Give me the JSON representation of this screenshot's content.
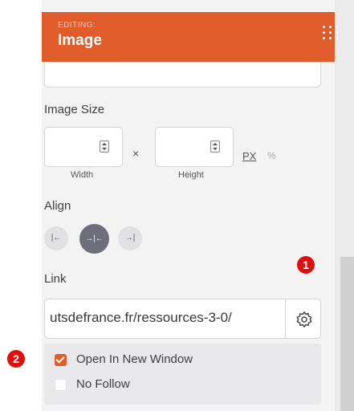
{
  "header": {
    "context": "EDITING:",
    "title": "Image",
    "menu_icon": "grid-dots-icon"
  },
  "image_size": {
    "label": "Image Size",
    "width_value": "",
    "width_label": "Width",
    "height_value": "",
    "height_label": "Height",
    "separator": "×",
    "unit_px": "PX",
    "unit_percent": "%",
    "selected_unit": "PX"
  },
  "align": {
    "label": "Align",
    "options": [
      {
        "name": "align-left-icon",
        "glyph": "|←"
      },
      {
        "name": "align-center-icon",
        "glyph": "→|←"
      },
      {
        "name": "align-right-icon",
        "glyph": "→|"
      }
    ],
    "selected": "center"
  },
  "link": {
    "label": "Link",
    "value": "utsdefrance.fr/ressources-3-0/",
    "settings_icon": "gear-icon"
  },
  "options": {
    "open_new_window": {
      "label": "Open In New Window",
      "checked": true
    },
    "no_follow": {
      "label": "No Follow",
      "checked": false
    }
  },
  "annotations": {
    "badge_1": "1",
    "badge_2": "2"
  },
  "colors": {
    "accent": "#e05c2a",
    "badge": "#dd0f0f",
    "active_align": "#6e6e7b"
  }
}
